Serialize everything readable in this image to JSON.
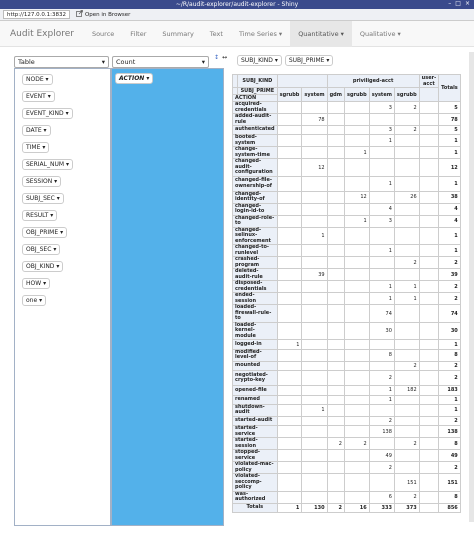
{
  "window": {
    "title": "~/R/audit-explorer/audit-explorer - Shiny",
    "controls": [
      "–",
      "□",
      "×"
    ]
  },
  "urlbar": {
    "url": "http://127.0.0.1:3832",
    "open_in_browser": "Open in Browser"
  },
  "nav": {
    "brand": "Audit Explorer",
    "items": [
      {
        "label": "Source",
        "dropdown": false
      },
      {
        "label": "Filter",
        "dropdown": false
      },
      {
        "label": "Summary",
        "dropdown": false
      },
      {
        "label": "Text",
        "dropdown": false
      },
      {
        "label": "Time Series",
        "dropdown": true
      },
      {
        "label": "Quantitative",
        "dropdown": true,
        "active": true
      },
      {
        "label": "Qualitative",
        "dropdown": true
      }
    ]
  },
  "pivot": {
    "renderer": "Table",
    "aggregator": "Count",
    "sort_icons": [
      "↕",
      "↔"
    ],
    "unused_attrs": [
      "NODE",
      "EVENT",
      "EVENT_KIND",
      "DATE",
      "TIME",
      "SERIAL_NUM",
      "SESSION",
      "SUBJ_SEC",
      "RESULT",
      "OBJ_PRIME",
      "OBJ_SEC",
      "OBJ_KIND",
      "HOW",
      "one"
    ],
    "row_attrs": [
      "ACTION"
    ],
    "col_attrs": [
      "SUBJ_KIND",
      "SUBJ_PRIME"
    ]
  },
  "table": {
    "header_subj_kind": "SUBJ_KIND",
    "header_subj_prime": "SUBJ_PRIME",
    "row_header": "ACTION",
    "totals_label": "Totals",
    "groups": [
      {
        "label": "",
        "span": 2
      },
      {
        "label": "priviliged-acct",
        "span": 4
      },
      {
        "label": "user-acct",
        "span": 1
      }
    ],
    "subcols": [
      "sgrubb",
      "system",
      "gdm",
      "sgrubb",
      "system",
      "sgrubb",
      ""
    ],
    "rows": [
      {
        "label": "acquired-credentials",
        "v": [
          "",
          "",
          "",
          "",
          "3",
          "2",
          ""
        ],
        "t": "5"
      },
      {
        "label": "added-audit-rule",
        "v": [
          "",
          "78",
          "",
          "",
          "",
          "",
          ""
        ],
        "t": "78"
      },
      {
        "label": "authenticated",
        "v": [
          "",
          "",
          "",
          "",
          "3",
          "2",
          ""
        ],
        "t": "5"
      },
      {
        "label": "booted-system",
        "v": [
          "",
          "",
          "",
          "",
          "1",
          "",
          ""
        ],
        "t": "1"
      },
      {
        "label": "change-system-time",
        "v": [
          "",
          "",
          "",
          "1",
          "",
          "",
          ""
        ],
        "t": "1"
      },
      {
        "label": "changed-audit-configuration",
        "v": [
          "",
          "12",
          "",
          "",
          "",
          "",
          ""
        ],
        "t": "12",
        "tall": true
      },
      {
        "label": "changed-file-ownership-of",
        "v": [
          "",
          "",
          "",
          "",
          "1",
          "",
          ""
        ],
        "t": "1",
        "tall": true
      },
      {
        "label": "changed-identity-of",
        "v": [
          "",
          "",
          "",
          "12",
          "",
          "26",
          ""
        ],
        "t": "38"
      },
      {
        "label": "changed-login-id-to",
        "v": [
          "",
          "",
          "",
          "",
          "4",
          "",
          ""
        ],
        "t": "4"
      },
      {
        "label": "changed-role-to",
        "v": [
          "",
          "",
          "",
          "1",
          "3",
          "",
          ""
        ],
        "t": "4"
      },
      {
        "label": "changed-selinux-enforcement",
        "v": [
          "",
          "1",
          "",
          "",
          "",
          "",
          ""
        ],
        "t": "1",
        "tall": true
      },
      {
        "label": "changed-to-runlevel",
        "v": [
          "",
          "",
          "",
          "",
          "1",
          "",
          ""
        ],
        "t": "1"
      },
      {
        "label": "crashed-program",
        "v": [
          "",
          "",
          "",
          "",
          "",
          "2",
          ""
        ],
        "t": "2"
      },
      {
        "label": "deleted-audit-rule",
        "v": [
          "",
          "39",
          "",
          "",
          "",
          "",
          ""
        ],
        "t": "39"
      },
      {
        "label": "disposed-credentials",
        "v": [
          "",
          "",
          "",
          "",
          "1",
          "1",
          ""
        ],
        "t": "2"
      },
      {
        "label": "ended-session",
        "v": [
          "",
          "",
          "",
          "",
          "1",
          "1",
          ""
        ],
        "t": "2"
      },
      {
        "label": "loaded-firewall-rule-to",
        "v": [
          "",
          "",
          "",
          "",
          "74",
          "",
          ""
        ],
        "t": "74",
        "tall": true
      },
      {
        "label": "loaded-kernel-module",
        "v": [
          "",
          "",
          "",
          "",
          "30",
          "",
          ""
        ],
        "t": "30",
        "tall": true
      },
      {
        "label": "logged-in",
        "v": [
          "1",
          "",
          "",
          "",
          "",
          "",
          ""
        ],
        "t": "1"
      },
      {
        "label": "modified-level-of",
        "v": [
          "",
          "",
          "",
          "",
          "8",
          "",
          ""
        ],
        "t": "8"
      },
      {
        "label": "mounted",
        "v": [
          "",
          "",
          "",
          "",
          "",
          "2",
          ""
        ],
        "t": "2"
      },
      {
        "label": "negotiated-crypto-key",
        "v": [
          "",
          "",
          "",
          "",
          "2",
          "",
          ""
        ],
        "t": "2",
        "tall": true
      },
      {
        "label": "opened-file",
        "v": [
          "",
          "",
          "",
          "",
          "1",
          "182",
          ""
        ],
        "t": "183"
      },
      {
        "label": "renamed",
        "v": [
          "",
          "",
          "",
          "",
          "1",
          "",
          ""
        ],
        "t": "1"
      },
      {
        "label": "shutdown-audit",
        "v": [
          "",
          "1",
          "",
          "",
          "",
          "",
          ""
        ],
        "t": "1"
      },
      {
        "label": "started-audit",
        "v": [
          "",
          "",
          "",
          "",
          "2",
          "",
          ""
        ],
        "t": "2"
      },
      {
        "label": "started-service",
        "v": [
          "",
          "",
          "",
          "",
          "138",
          "",
          ""
        ],
        "t": "138"
      },
      {
        "label": "started-session",
        "v": [
          "",
          "",
          "2",
          "2",
          "",
          "2",
          ""
        ],
        "t": "8"
      },
      {
        "label": "stopped-service",
        "v": [
          "",
          "",
          "",
          "",
          "49",
          "",
          ""
        ],
        "t": "49"
      },
      {
        "label": "violated-mac-policy",
        "v": [
          "",
          "",
          "",
          "",
          "2",
          "",
          ""
        ],
        "t": "2"
      },
      {
        "label": "violated-seccomp-policy",
        "v": [
          "",
          "",
          "",
          "",
          "",
          "151",
          ""
        ],
        "t": "151",
        "tall": true
      },
      {
        "label": "was-authorized",
        "v": [
          "",
          "",
          "",
          "",
          "6",
          "2",
          ""
        ],
        "t": "8"
      }
    ],
    "totals_row": {
      "label": "Totals",
      "v": [
        "1",
        "130",
        "2",
        "16",
        "333",
        "373",
        ""
      ],
      "t": "856"
    }
  }
}
